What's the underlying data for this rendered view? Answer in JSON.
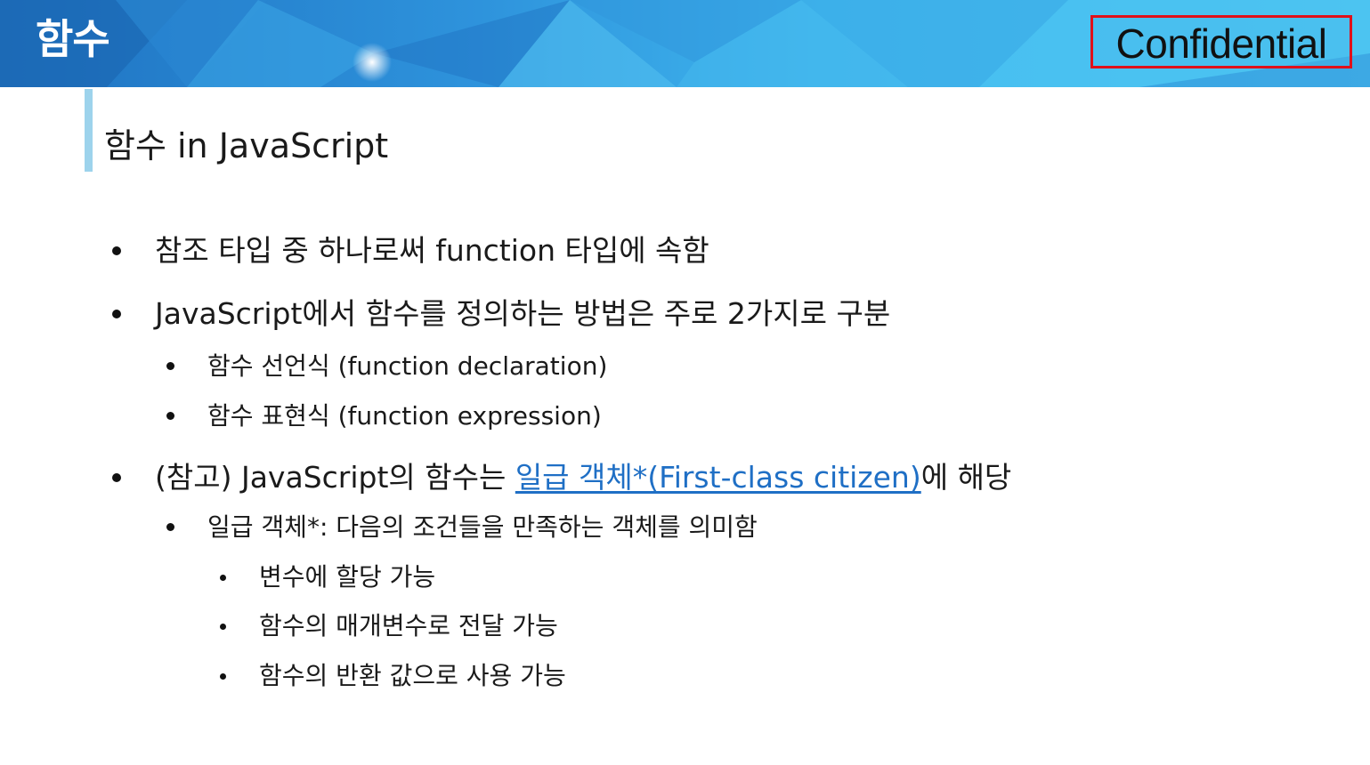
{
  "header": {
    "title": "함수",
    "confidential": "Confidential"
  },
  "section": {
    "title": "함수 in JavaScript"
  },
  "bullets": {
    "b1": "참조 타입 중 하나로써 function 타입에 속함",
    "b2": "JavaScript에서 함수를 정의하는 방법은 주로 2가지로 구분",
    "b2_1": "함수 선언식 (function declaration)",
    "b2_2": "함수 표현식 (function expression)",
    "b3_prefix": "(참고) JavaScript의 함수는 ",
    "b3_link": "일급 객체*(First-class citizen)",
    "b3_suffix": "에 해당",
    "b3_1": "일급 객체*: 다음의 조건들을 만족하는 객체를 의미함",
    "b3_1_1": "변수에 할당 가능",
    "b3_1_2": "함수의 매개변수로 전달 가능",
    "b3_1_3": "함수의 반환 값으로 사용 가능"
  },
  "colors": {
    "header_dark": "#1e78c8",
    "header_light": "#49baeb",
    "accent_bar": "#9dd3ec",
    "link": "#1f6fc5",
    "confidential_border": "#e0101a"
  }
}
